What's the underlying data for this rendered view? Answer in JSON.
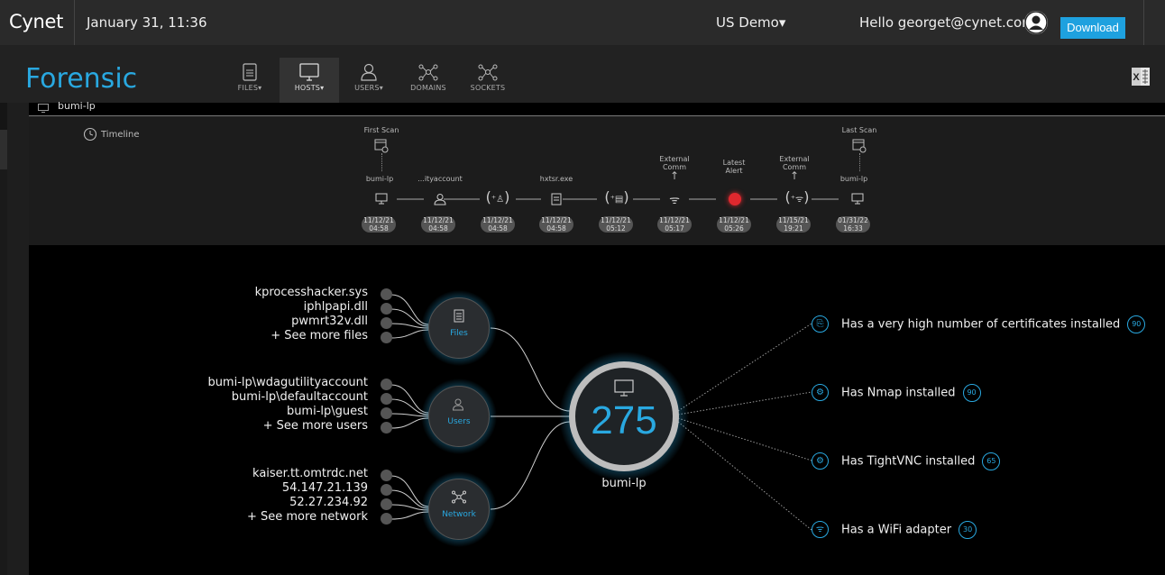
{
  "topbar": {
    "brand": "Cynet",
    "date": "January 31, 11:36",
    "environment": "US Demo",
    "greeting": "Hello georget@cynet.com",
    "download_label": "Download"
  },
  "page": {
    "title": "Forensic",
    "host": "bumi-lp"
  },
  "nav_tabs": [
    {
      "label": "FILES",
      "dropdown": true,
      "icon": "file-icon",
      "active": false
    },
    {
      "label": "HOSTS",
      "dropdown": true,
      "icon": "monitor-icon",
      "active": true
    },
    {
      "label": "USERS",
      "dropdown": true,
      "icon": "user-icon",
      "active": false
    },
    {
      "label": "DOMAINS",
      "dropdown": false,
      "icon": "network-icon",
      "active": false
    },
    {
      "label": "SOCKETS",
      "dropdown": false,
      "icon": "network-icon",
      "active": false
    }
  ],
  "timeline": {
    "title": "Timeline",
    "first_scan": "First Scan",
    "last_scan": "Last Scan",
    "events": [
      {
        "top": "",
        "label": "bumi-lp",
        "icon": "monitor-icon",
        "date": "11/12/21",
        "time": "04:58"
      },
      {
        "top": "",
        "label": "...ityaccount",
        "icon": "user-icon",
        "date": "11/12/21",
        "time": "04:58"
      },
      {
        "top": "",
        "label": "",
        "icon": "user-add-icon",
        "date": "11/12/21",
        "time": "04:58"
      },
      {
        "top": "",
        "label": "hxtsr.exe",
        "icon": "file-icon",
        "date": "11/12/21",
        "time": "04:58"
      },
      {
        "top": "",
        "label": "",
        "icon": "file-add-icon",
        "date": "11/12/21",
        "time": "05:12"
      },
      {
        "top": "External Comm",
        "label": "",
        "icon": "wifi-icon",
        "date": "11/12/21",
        "time": "05:17"
      },
      {
        "top": "Latest Alert",
        "label": "",
        "icon": "alert-icon",
        "date": "11/12/21",
        "time": "05:26"
      },
      {
        "top": "External Comm",
        "label": "",
        "icon": "wifi-add-icon",
        "date": "11/15/21",
        "time": "19:21"
      },
      {
        "top": "",
        "label": "bumi-lp",
        "icon": "monitor-icon",
        "date": "01/31/22",
        "time": "16:33"
      }
    ]
  },
  "graph": {
    "score": "275",
    "host": "bumi-lp",
    "groups": [
      {
        "name": "Files",
        "items": [
          "kprocesshacker.sys",
          "iphlpapi.dll",
          "pwmrt32v.dll",
          "+ See more files"
        ]
      },
      {
        "name": "Users",
        "items": [
          "bumi-lp\\wdagutilityaccount",
          "bumi-lp\\defaultaccount",
          "bumi-lp\\guest",
          "+ See more users"
        ]
      },
      {
        "name": "Network",
        "items": [
          "kaiser.tt.omtrdc.net",
          "54.147.21.139",
          "52.27.234.92",
          "+ See more network"
        ]
      }
    ],
    "findings": [
      {
        "text": "Has a very high number of certificates installed",
        "score": "90",
        "icon": "certificate-icon"
      },
      {
        "text": "Has Nmap installed",
        "score": "90",
        "icon": "gear-icon"
      },
      {
        "text": "Has TightVNC installed",
        "score": "65",
        "icon": "gear-icon"
      },
      {
        "text": "Has a WiFi adapter",
        "score": "30",
        "icon": "wifi-icon"
      }
    ]
  },
  "colors": {
    "accent": "#29a8e0",
    "alert": "#e0282e",
    "background": "#000000"
  }
}
